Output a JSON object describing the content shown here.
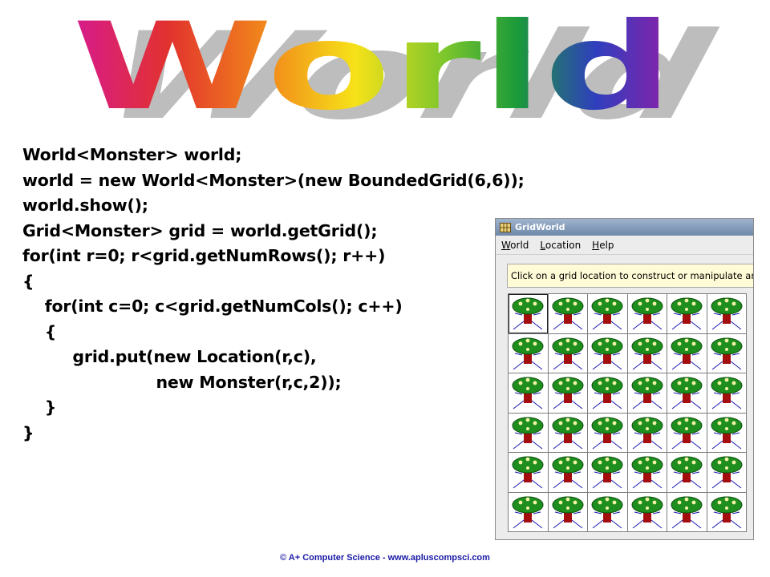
{
  "slide": {
    "title": "World",
    "title_gradient": [
      "#d61a8e",
      "#e2322e",
      "#f28c1a",
      "#f6e219",
      "#7cc62c",
      "#1b9a3a",
      "#2f3fbe",
      "#8e1fa8"
    ],
    "code_lines": [
      "World<Monster> world;",
      "world = new World<Monster>(new BoundedGrid(6,6));",
      "world.show();",
      "Grid<Monster> grid = world.getGrid();",
      "for(int r=0; r<grid.getNumRows(); r++)",
      "{",
      "    for(int c=0; c<grid.getNumCols(); c++)",
      "    {",
      "         grid.put(new Location(r,c),",
      "                        new Monster(r,c,2));",
      "    }",
      "}"
    ],
    "footer": "© A+ Computer Science  -  www.apluscompsci.com"
  },
  "gridworld": {
    "window_title": "GridWorld",
    "title_icon": "gridworld-app-icon",
    "menu": [
      {
        "label": "World",
        "mnemonic": "W"
      },
      {
        "label": "Location",
        "mnemonic": "L"
      },
      {
        "label": "Help",
        "mnemonic": "H"
      }
    ],
    "message": "Click on a grid location to construct or manipulate an occupant.",
    "rows": 6,
    "cols": 6,
    "selected_cell": [
      0,
      0
    ],
    "occupant_icon": "monster-icon",
    "colors": {
      "monster_head": "#1e8f1e",
      "monster_eyes": "#f5f2a8",
      "monster_body": "#a30d0d",
      "monster_legs": "#1a1ab0",
      "titlebar": "#7e96b6",
      "message_bg": "#fffbd6"
    }
  }
}
